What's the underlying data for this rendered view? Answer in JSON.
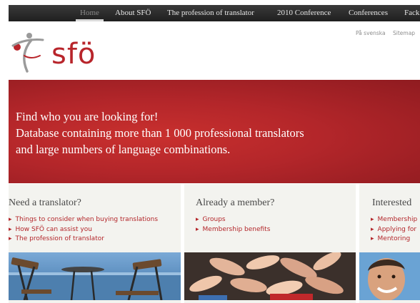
{
  "nav": {
    "items": [
      {
        "label": "Home",
        "active": true
      },
      {
        "label": "About SFÖ",
        "active": false
      },
      {
        "label": "The profession of translator",
        "active": false
      },
      {
        "label": "2010 Conference",
        "active": false
      },
      {
        "label": "Conferences",
        "active": false
      },
      {
        "label": "Fack",
        "active": false
      }
    ]
  },
  "header": {
    "lang_link": "På svenska",
    "sitemap_link": "Sitemap",
    "logo_text": "sfö"
  },
  "banner": {
    "line1": "Find who you are looking for!",
    "line2": "Database containing more than 1 000 professional translators",
    "line3": "and large numbers of language combinations."
  },
  "columns": [
    {
      "title": "Need a translator?",
      "links": [
        "Things to consider when buying translations",
        "How SFÖ can assist you",
        "The profession of translator"
      ],
      "image": "folding-chairs-and-table-by-the-sea"
    },
    {
      "title": "Already a member?",
      "links": [
        "Groups",
        "Membership benefits"
      ],
      "image": "many-hands-together"
    },
    {
      "title": "Interested",
      "links": [
        "Membership",
        "Applying for",
        "Mentoring"
      ],
      "image": "smiling-man"
    }
  ],
  "colors": {
    "brand_red": "#b3262a",
    "nav_bg": "#2a2a2a",
    "column_bg": "#f3f3ef"
  }
}
